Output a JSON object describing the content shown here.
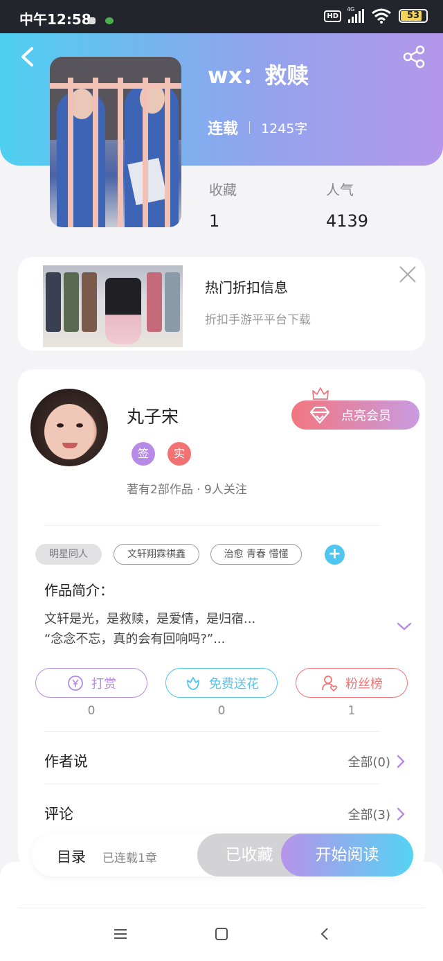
{
  "status_bar": {
    "time": "中午12:58",
    "hd_label": "HD",
    "network": "4G",
    "battery": "53",
    "notif_colors": [
      "#ffffff",
      "#4caf50"
    ]
  },
  "header": {
    "book_title": "wx：救赎",
    "status": "连载",
    "word_count": "1245字",
    "gradient": [
      "#4dd0f0",
      "#b497ea"
    ]
  },
  "stats": {
    "favorites_label": "收藏",
    "favorites_value": "1",
    "popularity_label": "人气",
    "popularity_value": "4139"
  },
  "ad": {
    "title": "热门折扣信息",
    "subtitle": "折扣手游平平台下载"
  },
  "author": {
    "name": "丸子宋",
    "badges": [
      {
        "label": "签",
        "color": "#b68ae6"
      },
      {
        "label": "实",
        "color": "#f27272"
      }
    ],
    "meta": "著有2部作品 · 9人关注",
    "vip_label": "点亮会员"
  },
  "tags": [
    "明星同人",
    "文轩翔霖祺鑫",
    "治愈 青春 懵懂"
  ],
  "intro": {
    "label": "作品简介：",
    "line1": "文轩是光，是救赎，是爱情，是归宿...",
    "line2": "“念念不忘，真的会有回响吗?”..."
  },
  "actions": [
    {
      "label": "打赏",
      "count": "0",
      "color": "#b68ae6"
    },
    {
      "label": "免费送花",
      "count": "0",
      "color": "#4fc6ef"
    },
    {
      "label": "粉丝榜",
      "count": "1",
      "color": "#f27272"
    }
  ],
  "sections": {
    "author_says": {
      "label": "作者说",
      "link": "全部(0)"
    },
    "comments": {
      "label": "评论",
      "link": "全部(3)"
    }
  },
  "bottom": {
    "catalog": "目录",
    "serial_status": "已连载1章",
    "collected": "已收藏",
    "start_reading": "开始阅读"
  },
  "icons": {
    "back": "back-icon",
    "share": "share-icon",
    "close": "close-icon",
    "crown": "crown-icon",
    "diamond": "diamond-icon",
    "plus": "plus-icon",
    "expand": "chevron-down-icon",
    "reward": "yen-icon",
    "flower": "flower-icon",
    "fans": "fans-icon",
    "chevron_right": "chevron-right-icon",
    "nav_menu": "menu-icon",
    "nav_home": "home-icon",
    "nav_back": "nav-back-icon"
  }
}
